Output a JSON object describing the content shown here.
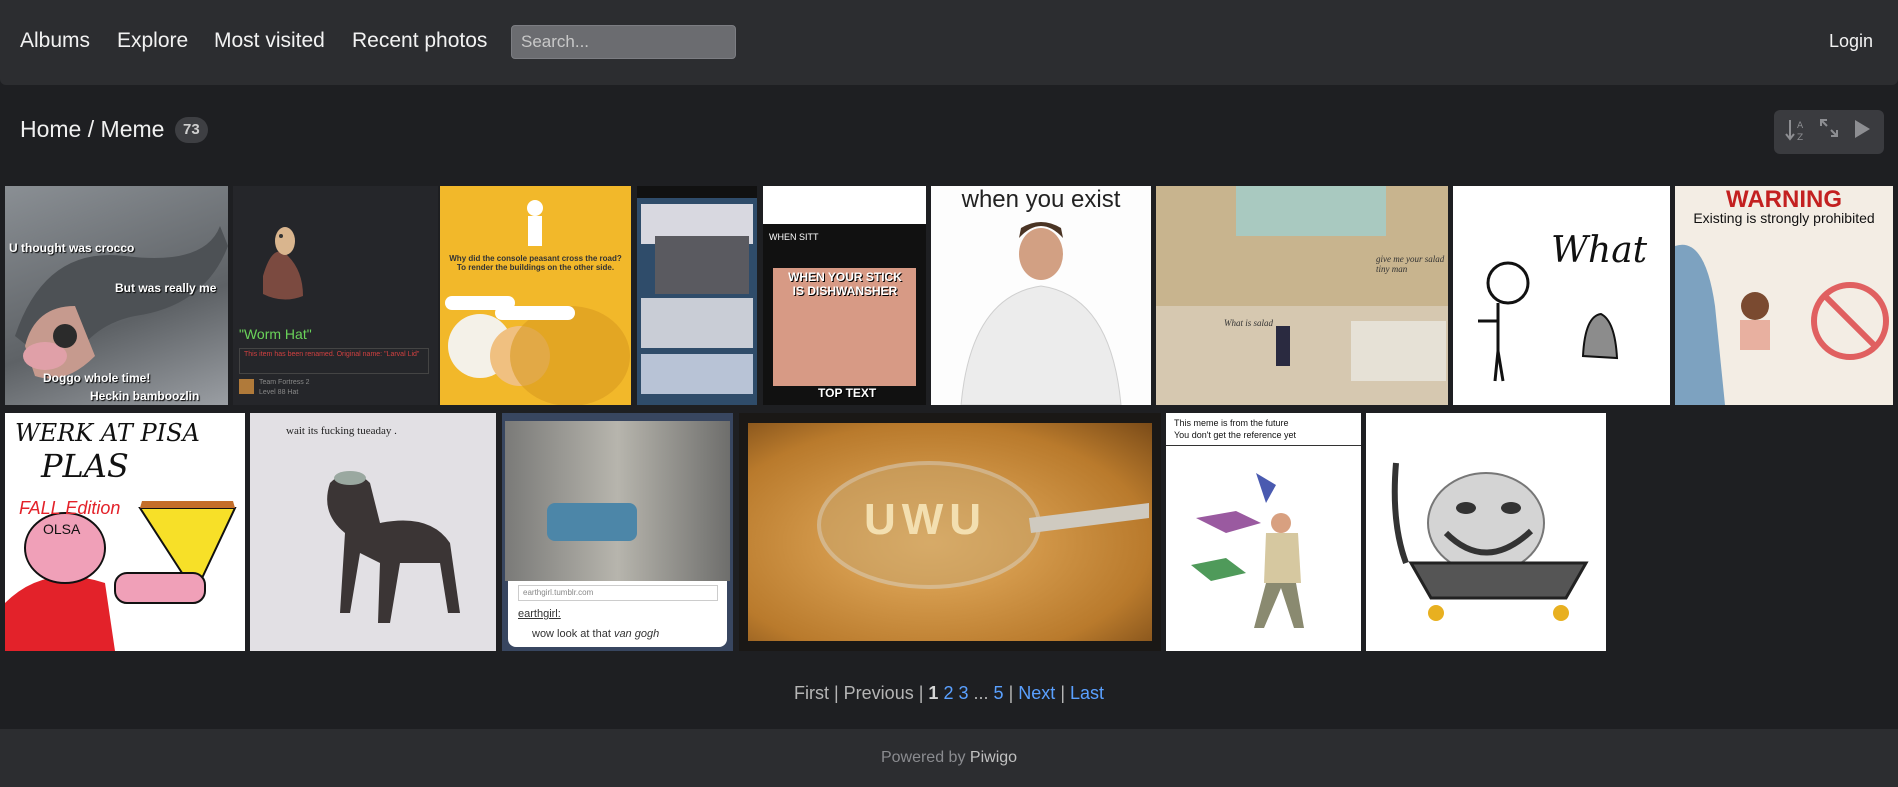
{
  "nav": {
    "items": [
      "Albums",
      "Explore",
      "Most visited",
      "Recent photos"
    ],
    "search_placeholder": "Search...",
    "login": "Login"
  },
  "breadcrumb": {
    "home": "Home",
    "separator": "/",
    "album": "Meme",
    "count": "73"
  },
  "toolbar": {
    "icons": [
      "sort-icon",
      "fullscreen-icon",
      "slideshow-play-icon"
    ]
  },
  "thumbnails": {
    "row1": [
      {
        "name": "pug-crocodile",
        "text": [
          "U thought was crocco",
          "But was really me",
          "Doggo whole time!",
          "Heckin bamboozlin"
        ]
      },
      {
        "name": "worm-hat",
        "title": "\"Worm Hat\"",
        "note": "This item has been renamed. Original name: \"Larval Lid\"",
        "game": "Team Fortress 2",
        "level": "Level 88 Hat"
      },
      {
        "name": "console-peasant",
        "caption": "Why did the console peasant cross the road? To render the buildings on the other side."
      },
      {
        "name": "phone-screenshot-stack"
      },
      {
        "name": "dishwasher-stick",
        "top": "WHEN SITT",
        "main": "WHEN YOUR STICK IS DISHWANSHER",
        "bottom": "TOP TEXT"
      },
      {
        "name": "when-you-exist",
        "caption": "when you exist"
      },
      {
        "name": "kitchen-salad",
        "text1": "give me your salad tiny man",
        "text2": "What is salad"
      },
      {
        "name": "stick-figure-what",
        "caption": "What"
      },
      {
        "name": "warning-existing",
        "title": "WARNING",
        "caption": "Existing is strongly prohibited"
      }
    ],
    "row2": [
      {
        "name": "werk-at-pisa",
        "text": [
          "WERK AT PISA",
          "PLAS",
          "FALL Edition",
          "OLSA"
        ]
      },
      {
        "name": "fucking-tuesday-dog",
        "caption": "wait its fucking tueaday ."
      },
      {
        "name": "van-gogh-van",
        "site": "earthgirl.tumblr.com",
        "user": "earthgirl:",
        "caption": "wow look at that",
        "caption_em": "van gogh"
      },
      {
        "name": "uwu-soup-spoon",
        "text": "UWU"
      },
      {
        "name": "meme-from-future",
        "caption": [
          "This meme is from the future",
          "You don't get the reference yet"
        ]
      },
      {
        "name": "trollface-cart"
      }
    ]
  },
  "pagination": {
    "first": "First",
    "sep": "|",
    "previous": "Previous",
    "current": "1",
    "pages": [
      "2",
      "3"
    ],
    "ellipsis": "...",
    "last_page": "5",
    "next": "Next",
    "last": "Last"
  },
  "footer": {
    "prefix": "Powered by",
    "brand": "Piwigo"
  }
}
